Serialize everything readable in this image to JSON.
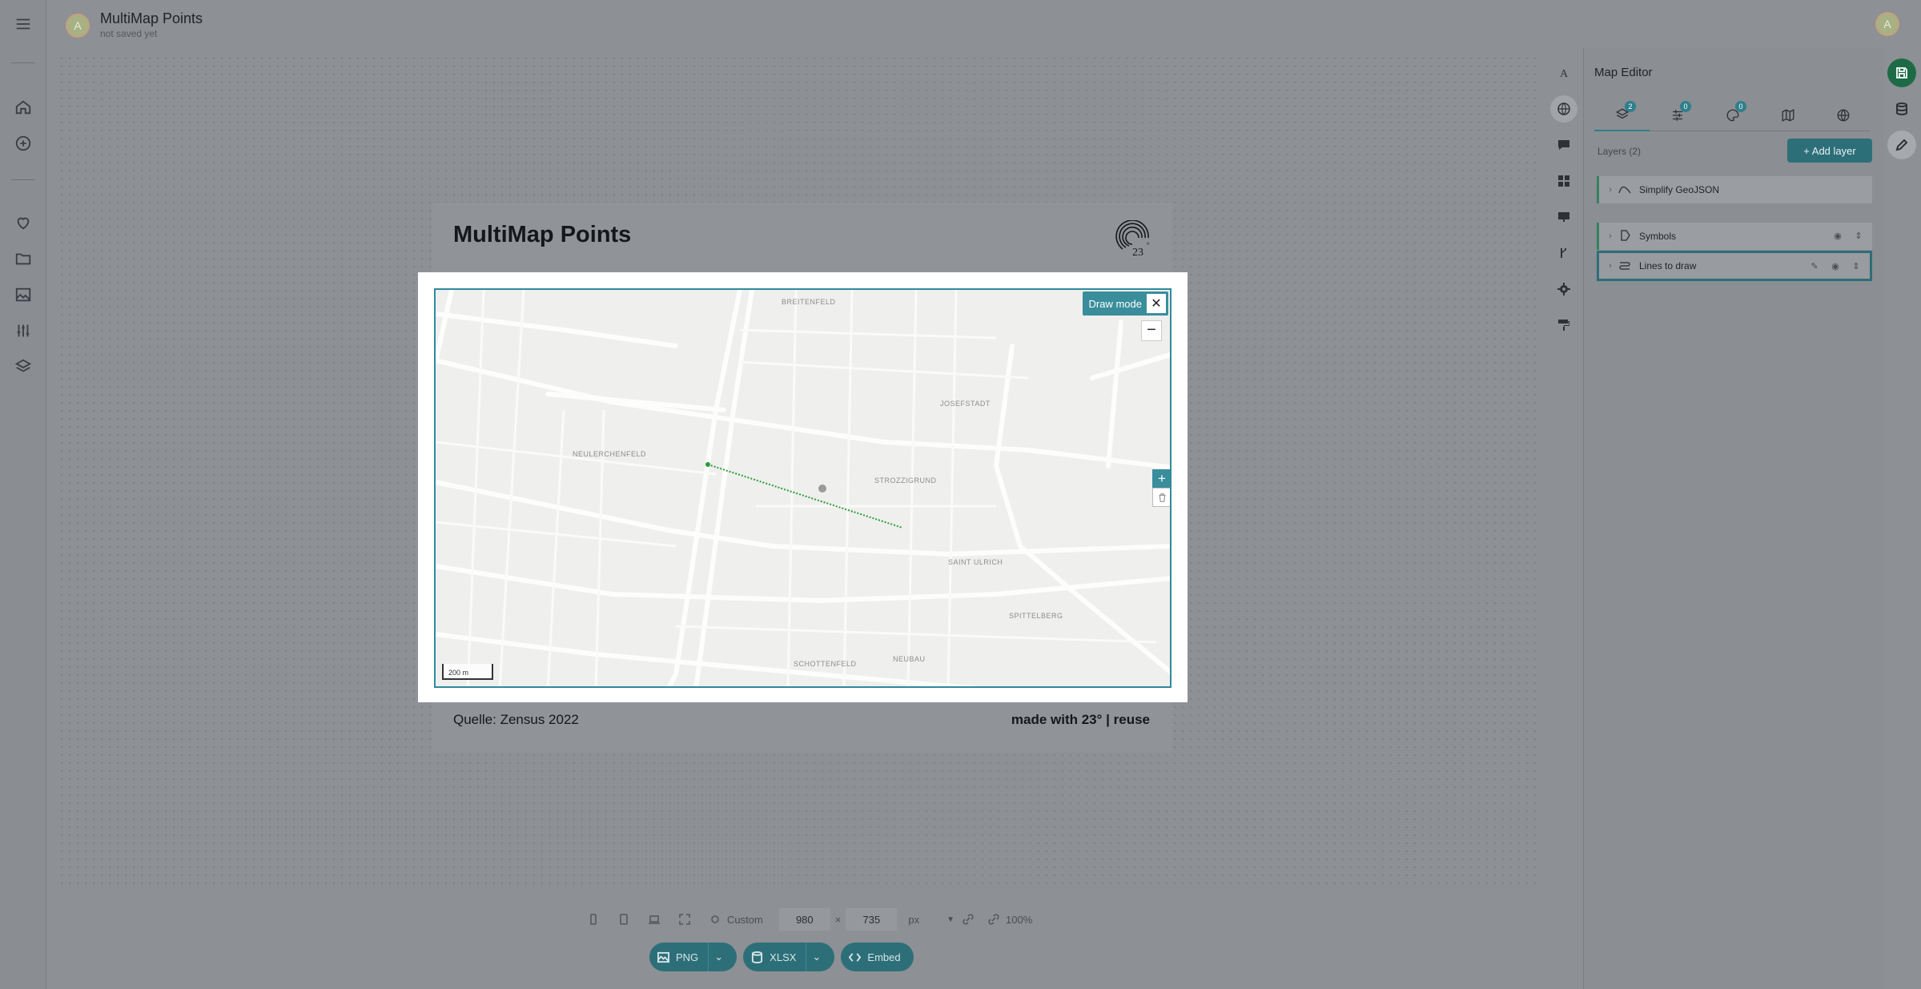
{
  "app": {
    "avatar_initial": "A",
    "title": "MultiMap Points",
    "subtitle": "not saved yet",
    "user_initial": "A"
  },
  "rail": {
    "icons": [
      "menu-icon",
      "home-icon",
      "plus-circle-icon",
      "heart-icon",
      "folder-icon",
      "image-icon",
      "sliders-icon",
      "layers-icon"
    ]
  },
  "card": {
    "title": "MultiMap Points",
    "source": "Quelle: Zensus 2022",
    "credit": "made with 23° | reuse"
  },
  "map": {
    "districts": [
      "BREITENFELD",
      "JOSEFSTADT",
      "NEULERCHENFELD",
      "STROZZIGRUND",
      "SAINT ULRICH",
      "SPITTELBERG",
      "SCHOTTENFELD",
      "NEUBAU"
    ],
    "scale_label": "200 m",
    "draw_mode_label": "Draw mode",
    "close_symbol": "✕",
    "zoom_out_symbol": "−",
    "add_symbol": "+",
    "trash_symbol": "🗑"
  },
  "tools": {
    "icons": [
      "text-icon",
      "globe-icon",
      "comment-icon",
      "grid-icon",
      "presentation-icon",
      "fork-icon",
      "gear-icon",
      "paint-roller-icon"
    ]
  },
  "panel": {
    "title": "Map Editor",
    "tabs": [
      {
        "icon": "layers-icon",
        "badge": "2"
      },
      {
        "icon": "filter-icon",
        "badge": "0"
      },
      {
        "icon": "palette-icon",
        "badge": "0"
      },
      {
        "icon": "map-icon",
        "badge": ""
      },
      {
        "icon": "globe-icon",
        "badge": ""
      }
    ],
    "layers_label": "Layers (2)",
    "add_layer_label": "+ Add layer",
    "layers": [
      {
        "name": "Simplify GeoJSON"
      },
      {
        "name": "Symbols"
      },
      {
        "name": "Lines to draw"
      }
    ]
  },
  "far_rail": {
    "icons": [
      "save-icon",
      "database-icon",
      "pencil-icon"
    ]
  },
  "bottom": {
    "preset_label": "Custom",
    "width": "980",
    "times": "×",
    "height": "735",
    "unit": "px",
    "zoom": "100%",
    "png_label": "PNG",
    "xlsx_label": "XLSX",
    "embed_label": "Embed"
  },
  "colors": {
    "accent": "#2d6f79",
    "draw_line": "#2a9d3a"
  }
}
